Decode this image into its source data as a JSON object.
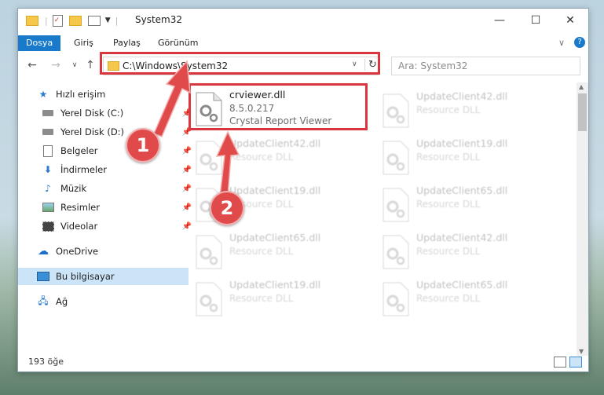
{
  "window": {
    "title": "System32"
  },
  "controls": {
    "minimize": "—",
    "maximize": "☐",
    "close": "✕"
  },
  "ribbon": {
    "tabs": [
      "Dosya",
      "Giriş",
      "Paylaş",
      "Görünüm"
    ],
    "collapse": "∨",
    "help": "?"
  },
  "nav": {
    "back": "←",
    "forward": "→",
    "recent": "∨",
    "up": "↑",
    "address": "C:\\Windows\\System32",
    "dropdown": "∨",
    "refresh": "↻",
    "search_placeholder": "Ara: System32"
  },
  "sidebar": {
    "items": [
      {
        "label": "Hızlı erişim",
        "icon": "star-icon"
      },
      {
        "label": "Yerel Disk (C:)",
        "icon": "drive-icon"
      },
      {
        "label": "Yerel Disk (D:)",
        "icon": "drive-icon"
      },
      {
        "label": "Belgeler",
        "icon": "documents-icon"
      },
      {
        "label": "İndirmeler",
        "icon": "download-icon"
      },
      {
        "label": "Müzik",
        "icon": "music-icon"
      },
      {
        "label": "Resimler",
        "icon": "pictures-icon"
      },
      {
        "label": "Videolar",
        "icon": "videos-icon"
      },
      {
        "label": "OneDrive",
        "icon": "cloud-icon"
      },
      {
        "label": "Bu bilgisayar",
        "icon": "computer-icon"
      },
      {
        "label": "Ağ",
        "icon": "network-icon"
      }
    ]
  },
  "files": {
    "highlighted": {
      "name": "crviewer.dll",
      "version": "8.5.0.217",
      "description": "Crystal Report Viewer"
    },
    "left_column": [
      {
        "name": "UpdateClient42.dll",
        "description": "Resource DLL"
      },
      {
        "name": "UpdateClient19.dll",
        "description": "Resource DLL"
      },
      {
        "name": "UpdateClient65.dll",
        "description": "Resource DLL"
      },
      {
        "name": "UpdateClient19.dll",
        "description": "Resource DLL"
      }
    ],
    "right_column": [
      {
        "name": "UpdateClient42.dll",
        "description": "Resource DLL"
      },
      {
        "name": "UpdateClient19.dll",
        "description": "Resource DLL"
      },
      {
        "name": "UpdateClient65.dll",
        "description": "Resource DLL"
      },
      {
        "name": "UpdateClient42.dll",
        "description": "Resource DLL"
      },
      {
        "name": "UpdateClient65.dll",
        "description": "Resource DLL"
      }
    ]
  },
  "status": {
    "count": "193 öğe"
  },
  "annotations": {
    "step1": "1",
    "step2": "2"
  },
  "colors": {
    "accent": "#1979ca",
    "highlight": "#d9363e",
    "marker": "#e04a4a"
  }
}
